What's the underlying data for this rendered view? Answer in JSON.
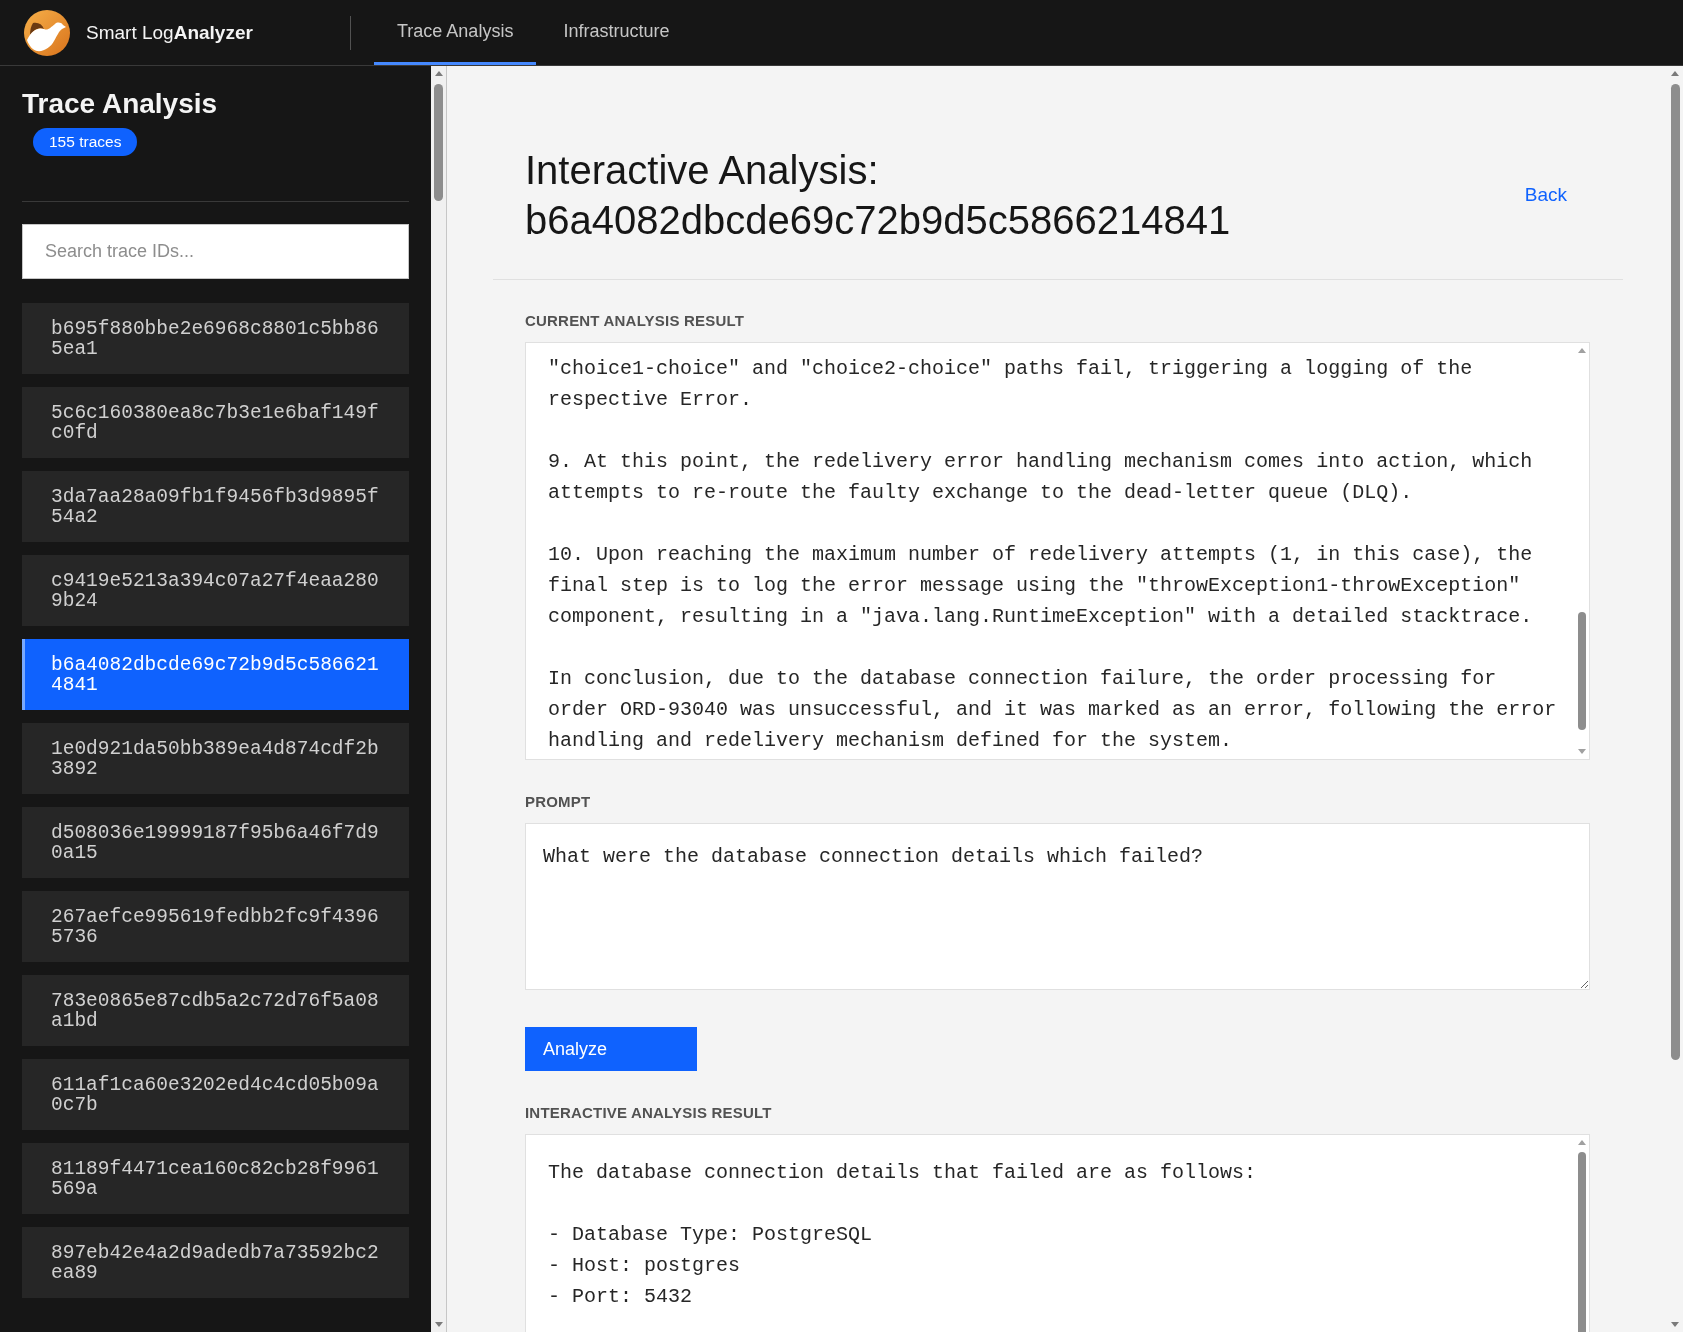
{
  "app_header": {
    "brand": "Smart Log**Analyzer**",
    "tabs": [
      {
        "label": "Trace Analysis",
        "selected": true
      },
      {
        "label": "Infrastructure",
        "selected": false
      }
    ]
  },
  "sidebar": {
    "title": "Trace Analysis",
    "badge": "155 traces",
    "search": {
      "placeholder": "Search trace IDs..."
    },
    "traces": [
      {
        "id": "b695f880bbe2e6968c8801c5bb865ea1",
        "selected": false
      },
      {
        "id": "5c6c160380ea8c7b3e1e6baf149fc0fd",
        "selected": false
      },
      {
        "id": "3da7aa28a09fb1f9456fb3d9895f54a2",
        "selected": false
      },
      {
        "id": "c9419e5213a394c07a27f4eaa2809b24",
        "selected": false
      },
      {
        "id": "b6a4082dbcde69c72b9d5c5866214841",
        "selected": true
      },
      {
        "id": "1e0d921da50bb389ea4d874cdf2b3892",
        "selected": false
      },
      {
        "id": "d508036e19999187f95b6a46f7d90a15",
        "selected": false
      },
      {
        "id": "267aefce995619fedbb2fc9f43965736",
        "selected": false
      },
      {
        "id": "783e0865e87cdb5a2c72d76f5a08a1bd",
        "selected": false
      },
      {
        "id": "611af1ca60e3202ed4c4cd05b09a0c7b",
        "selected": false
      },
      {
        "id": "81189f4471cea160c82cb28f9961569a",
        "selected": false
      },
      {
        "id": "897eb42e4a2d9adedb7a73592bc2ea89",
        "selected": false
      }
    ]
  },
  "main": {
    "title": "Interactive Analysis: b6a4082dbcde69c72b9d5c5866214841",
    "back_link": "Back",
    "current_result": {
      "label": "CURRENT ANALYSIS RESULT",
      "paragraphs": [
        "\"choice1-choice\" and \"choice2-choice\" paths fail, triggering a logging of the respective Error.",
        "9. At this point, the redelivery error handling mechanism comes into action, which attempts to re-route the faulty exchange to the dead-letter queue (DLQ).",
        "10. Upon reaching the maximum number of redelivery attempts (1, in this case), the final step is to log the error message using the \"throwException1-throwException\" component, resulting in a \"java.lang.RuntimeException\" with a detailed stacktrace.",
        "In conclusion, due to the database connection failure, the order processing for order ORD-93040 was unsuccessful, and it was marked as an error, following the error handling and redelivery mechanism defined for the system."
      ]
    },
    "prompt": {
      "label": "PROMPT",
      "value": "What were the database connection details which failed?"
    },
    "analyze_button": "Analyze",
    "interactive_result": {
      "label": "INTERACTIVE ANALYSIS RESULT",
      "blocks": [
        {
          "lines": [
            "The database connection details that failed are as follows:"
          ]
        },
        {
          "lines": [
            "- Database Type: PostgreSQL",
            "- Host: postgres",
            "- Port: 5432"
          ]
        }
      ]
    }
  }
}
